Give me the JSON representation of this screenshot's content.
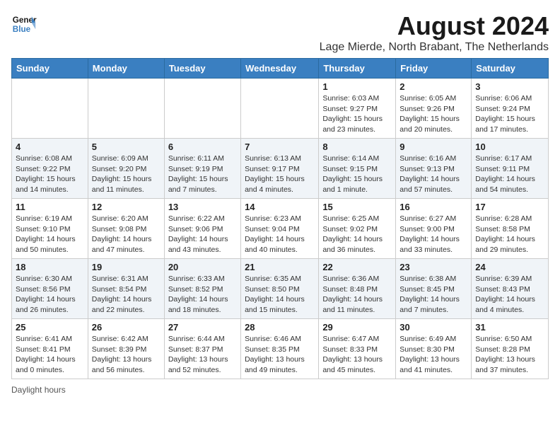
{
  "logo": {
    "line1": "General",
    "line2": "Blue"
  },
  "title": "August 2024",
  "location": "Lage Mierde, North Brabant, The Netherlands",
  "days_of_week": [
    "Sunday",
    "Monday",
    "Tuesday",
    "Wednesday",
    "Thursday",
    "Friday",
    "Saturday"
  ],
  "weeks": [
    [
      {
        "day": "",
        "info": ""
      },
      {
        "day": "",
        "info": ""
      },
      {
        "day": "",
        "info": ""
      },
      {
        "day": "",
        "info": ""
      },
      {
        "day": "1",
        "info": "Sunrise: 6:03 AM\nSunset: 9:27 PM\nDaylight: 15 hours\nand 23 minutes."
      },
      {
        "day": "2",
        "info": "Sunrise: 6:05 AM\nSunset: 9:26 PM\nDaylight: 15 hours\nand 20 minutes."
      },
      {
        "day": "3",
        "info": "Sunrise: 6:06 AM\nSunset: 9:24 PM\nDaylight: 15 hours\nand 17 minutes."
      }
    ],
    [
      {
        "day": "4",
        "info": "Sunrise: 6:08 AM\nSunset: 9:22 PM\nDaylight: 15 hours\nand 14 minutes."
      },
      {
        "day": "5",
        "info": "Sunrise: 6:09 AM\nSunset: 9:20 PM\nDaylight: 15 hours\nand 11 minutes."
      },
      {
        "day": "6",
        "info": "Sunrise: 6:11 AM\nSunset: 9:19 PM\nDaylight: 15 hours\nand 7 minutes."
      },
      {
        "day": "7",
        "info": "Sunrise: 6:13 AM\nSunset: 9:17 PM\nDaylight: 15 hours\nand 4 minutes."
      },
      {
        "day": "8",
        "info": "Sunrise: 6:14 AM\nSunset: 9:15 PM\nDaylight: 15 hours\nand 1 minute."
      },
      {
        "day": "9",
        "info": "Sunrise: 6:16 AM\nSunset: 9:13 PM\nDaylight: 14 hours\nand 57 minutes."
      },
      {
        "day": "10",
        "info": "Sunrise: 6:17 AM\nSunset: 9:11 PM\nDaylight: 14 hours\nand 54 minutes."
      }
    ],
    [
      {
        "day": "11",
        "info": "Sunrise: 6:19 AM\nSunset: 9:10 PM\nDaylight: 14 hours\nand 50 minutes."
      },
      {
        "day": "12",
        "info": "Sunrise: 6:20 AM\nSunset: 9:08 PM\nDaylight: 14 hours\nand 47 minutes."
      },
      {
        "day": "13",
        "info": "Sunrise: 6:22 AM\nSunset: 9:06 PM\nDaylight: 14 hours\nand 43 minutes."
      },
      {
        "day": "14",
        "info": "Sunrise: 6:23 AM\nSunset: 9:04 PM\nDaylight: 14 hours\nand 40 minutes."
      },
      {
        "day": "15",
        "info": "Sunrise: 6:25 AM\nSunset: 9:02 PM\nDaylight: 14 hours\nand 36 minutes."
      },
      {
        "day": "16",
        "info": "Sunrise: 6:27 AM\nSunset: 9:00 PM\nDaylight: 14 hours\nand 33 minutes."
      },
      {
        "day": "17",
        "info": "Sunrise: 6:28 AM\nSunset: 8:58 PM\nDaylight: 14 hours\nand 29 minutes."
      }
    ],
    [
      {
        "day": "18",
        "info": "Sunrise: 6:30 AM\nSunset: 8:56 PM\nDaylight: 14 hours\nand 26 minutes."
      },
      {
        "day": "19",
        "info": "Sunrise: 6:31 AM\nSunset: 8:54 PM\nDaylight: 14 hours\nand 22 minutes."
      },
      {
        "day": "20",
        "info": "Sunrise: 6:33 AM\nSunset: 8:52 PM\nDaylight: 14 hours\nand 18 minutes."
      },
      {
        "day": "21",
        "info": "Sunrise: 6:35 AM\nSunset: 8:50 PM\nDaylight: 14 hours\nand 15 minutes."
      },
      {
        "day": "22",
        "info": "Sunrise: 6:36 AM\nSunset: 8:48 PM\nDaylight: 14 hours\nand 11 minutes."
      },
      {
        "day": "23",
        "info": "Sunrise: 6:38 AM\nSunset: 8:45 PM\nDaylight: 14 hours\nand 7 minutes."
      },
      {
        "day": "24",
        "info": "Sunrise: 6:39 AM\nSunset: 8:43 PM\nDaylight: 14 hours\nand 4 minutes."
      }
    ],
    [
      {
        "day": "25",
        "info": "Sunrise: 6:41 AM\nSunset: 8:41 PM\nDaylight: 14 hours\nand 0 minutes."
      },
      {
        "day": "26",
        "info": "Sunrise: 6:42 AM\nSunset: 8:39 PM\nDaylight: 13 hours\nand 56 minutes."
      },
      {
        "day": "27",
        "info": "Sunrise: 6:44 AM\nSunset: 8:37 PM\nDaylight: 13 hours\nand 52 minutes."
      },
      {
        "day": "28",
        "info": "Sunrise: 6:46 AM\nSunset: 8:35 PM\nDaylight: 13 hours\nand 49 minutes."
      },
      {
        "day": "29",
        "info": "Sunrise: 6:47 AM\nSunset: 8:33 PM\nDaylight: 13 hours\nand 45 minutes."
      },
      {
        "day": "30",
        "info": "Sunrise: 6:49 AM\nSunset: 8:30 PM\nDaylight: 13 hours\nand 41 minutes."
      },
      {
        "day": "31",
        "info": "Sunrise: 6:50 AM\nSunset: 8:28 PM\nDaylight: 13 hours\nand 37 minutes."
      }
    ]
  ],
  "footer": "Daylight hours"
}
